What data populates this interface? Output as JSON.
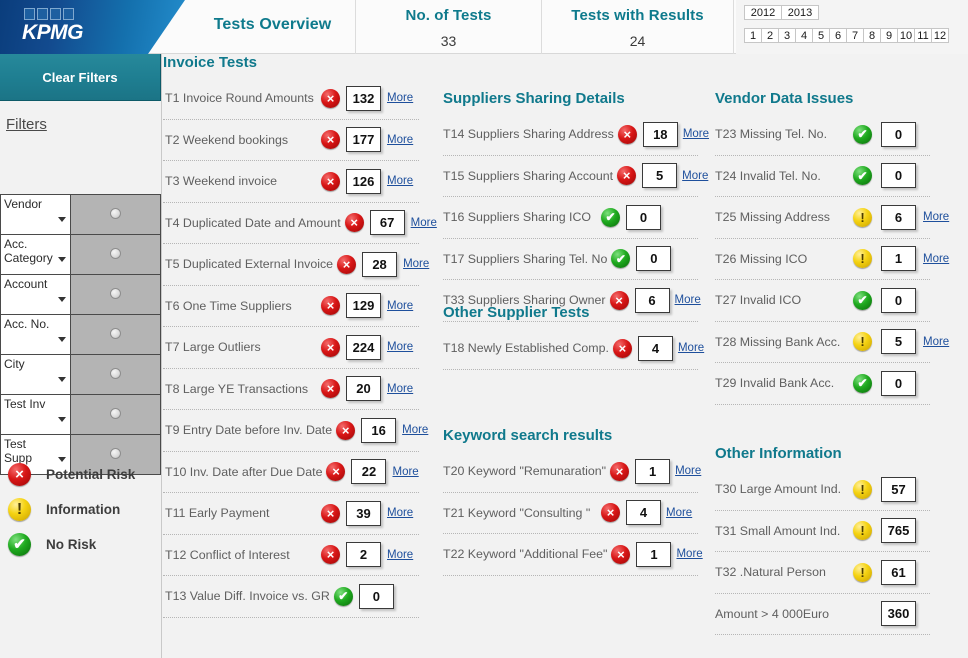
{
  "brand": {
    "logo_text": "KPMG",
    "logo_squares": 4,
    "accent_teal": "#10798c",
    "header_blue": "#0a3d7c",
    "link_blue": "#1e4f9c"
  },
  "header": {
    "app_title": "Tests Overview",
    "stats": [
      {
        "title": "No. of Tests",
        "value": "33"
      },
      {
        "title": "Tests with Results",
        "value": "24"
      }
    ],
    "years": [
      "2012",
      "2013"
    ],
    "months": [
      "1",
      "2",
      "3",
      "4",
      "5",
      "6",
      "7",
      "8",
      "9",
      "10",
      "11",
      "12"
    ]
  },
  "sidebar": {
    "clear_filters_label": "Clear Filters",
    "filters_title": "Filters",
    "filters": [
      {
        "label": "Vendor",
        "selected": false
      },
      {
        "label": "Acc. Category",
        "selected": false
      },
      {
        "label": "Account",
        "selected": false
      },
      {
        "label": "Acc. No.",
        "selected": false
      },
      {
        "label": "City",
        "selected": false
      },
      {
        "label": "Test Inv",
        "selected": false
      },
      {
        "label": "Test Supp",
        "selected": false
      }
    ],
    "legend": [
      {
        "status": "red",
        "label": "Potential Risk"
      },
      {
        "status": "yellow",
        "label": "Information"
      },
      {
        "status": "green",
        "label": "No Risk"
      }
    ]
  },
  "groups": [
    {
      "id": "invoice-tests",
      "title": "Invoice Tests",
      "column": 1,
      "tests": [
        {
          "code": "T1",
          "label": "T1 Invoice Round Amounts",
          "status": "red",
          "value": "132",
          "more": "More"
        },
        {
          "code": "T2",
          "label": "T2 Weekend bookings",
          "status": "red",
          "value": "177",
          "more": "More"
        },
        {
          "code": "T3",
          "label": "T3 Weekend invoice",
          "status": "red",
          "value": "126",
          "more": "More"
        },
        {
          "code": "T4",
          "label": "T4 Duplicated Date and Amount",
          "status": "red",
          "value": "67",
          "more": "More"
        },
        {
          "code": "T5",
          "label": "T5 Duplicated External Invoice",
          "status": "red",
          "value": "28",
          "more": "More"
        },
        {
          "code": "T6",
          "label": "T6 One Time Suppliers",
          "status": "red",
          "value": "129",
          "more": "More"
        },
        {
          "code": "T7",
          "label": "T7 Large Outliers",
          "status": "red",
          "value": "224",
          "more": "More"
        },
        {
          "code": "T8",
          "label": "T8 Large YE Transactions",
          "status": "red",
          "value": "20",
          "more": "More"
        },
        {
          "code": "T9",
          "label": "T9 Entry Date before Inv. Date",
          "status": "red",
          "value": "16",
          "more": "More"
        },
        {
          "code": "T10",
          "label": "T10 Inv. Date after Due Date",
          "status": "red",
          "value": "22",
          "more": "More"
        },
        {
          "code": "T11",
          "label": "T11 Early Payment",
          "status": "red",
          "value": "39",
          "more": "More"
        },
        {
          "code": "T12",
          "label": "T12 Conflict of Interest",
          "status": "red",
          "value": "2",
          "more": "More"
        },
        {
          "code": "T13",
          "label": "T13 Value Diff. Invoice vs. GR",
          "status": "green",
          "value": "0",
          "more": ""
        }
      ]
    },
    {
      "id": "suppliers-sharing-details",
      "title": "Suppliers Sharing Details",
      "column": 2,
      "tests": [
        {
          "code": "T14",
          "label": "T14 Suppliers Sharing Address",
          "status": "red",
          "value": "18",
          "more": "More"
        },
        {
          "code": "T15",
          "label": "T15 Suppliers Sharing Account",
          "status": "red",
          "value": "5",
          "more": "More"
        },
        {
          "code": "T16",
          "label": "T16 Suppliers Sharing ICO",
          "status": "green",
          "value": "0",
          "more": ""
        },
        {
          "code": "T17",
          "label": "T17 Suppliers Sharing Tel. No",
          "status": "green",
          "value": "0",
          "more": ""
        },
        {
          "code": "T33",
          "label": "T33 Suppliers Sharing Owner",
          "status": "red",
          "value": "6",
          "more": "More"
        }
      ]
    },
    {
      "id": "other-supplier-tests",
      "title": "Other Supplier Tests",
      "column": 2,
      "tests": [
        {
          "code": "T18",
          "label": "T18 Newly Established Comp.",
          "status": "red",
          "value": "4",
          "more": "More"
        }
      ]
    },
    {
      "id": "keyword-search-results",
      "title": "Keyword search results",
      "column": 2,
      "tests": [
        {
          "code": "T20",
          "label": "T20 Keyword \"Remunaration\"",
          "status": "red",
          "value": "1",
          "more": "More"
        },
        {
          "code": "T21",
          "label": "T21 Keyword \"Consulting \"",
          "status": "red",
          "value": "4",
          "more": "More"
        },
        {
          "code": "T22",
          "label": "T22 Keyword \"Additional Fee\"",
          "status": "red",
          "value": "1",
          "more": "More"
        }
      ]
    },
    {
      "id": "vendor-data-issues",
      "title": "Vendor Data Issues",
      "column": 3,
      "tests": [
        {
          "code": "T23",
          "label": "T23 Missing Tel. No.",
          "status": "green",
          "value": "0",
          "more": ""
        },
        {
          "code": "T24",
          "label": "T24 Invalid Tel. No.",
          "status": "green",
          "value": "0",
          "more": ""
        },
        {
          "code": "T25",
          "label": "T25 Missing Address",
          "status": "yellow",
          "value": "6",
          "more": "More"
        },
        {
          "code": "T26",
          "label": "T26 Missing ICO",
          "status": "yellow",
          "value": "1",
          "more": "More"
        },
        {
          "code": "T27",
          "label": "T27 Invalid ICO",
          "status": "green",
          "value": "0",
          "more": ""
        },
        {
          "code": "T28",
          "label": "T28 Missing Bank Acc.",
          "status": "yellow",
          "value": "5",
          "more": "More"
        },
        {
          "code": "T29",
          "label": "T29 Invalid Bank Acc.",
          "status": "green",
          "value": "0",
          "more": ""
        }
      ]
    },
    {
      "id": "other-information",
      "title": "Other Information",
      "column": 3,
      "tests": [
        {
          "code": "T30",
          "label": "T30 Large Amount Ind.",
          "status": "yellow",
          "value": "57",
          "more": ""
        },
        {
          "code": "T31",
          "label": "T31 Small Amount Ind.",
          "status": "yellow",
          "value": "765",
          "more": ""
        },
        {
          "code": "T32",
          "label": "T32 .Natural Person",
          "status": "yellow",
          "value": "61",
          "more": ""
        },
        {
          "code": "",
          "label": "Amount > 4 000Euro",
          "status": "none",
          "value": "360",
          "more": ""
        }
      ]
    }
  ]
}
